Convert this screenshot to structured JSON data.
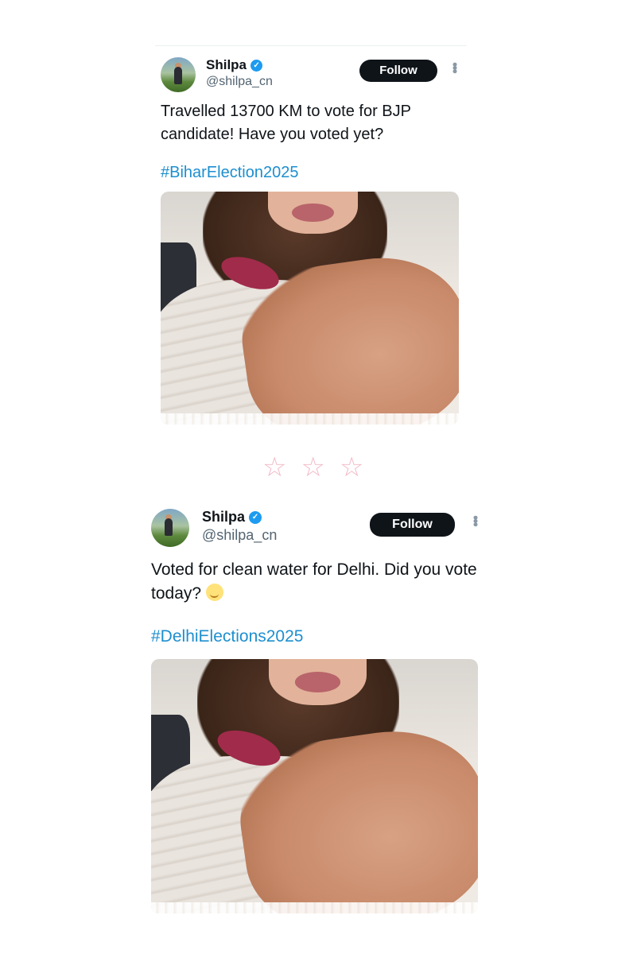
{
  "tweets": [
    {
      "name": "Shilpa",
      "handle": "@shilpa_cn",
      "follow_label": "Follow",
      "more_icon": "vertical-dots",
      "text": "Travelled 13700 KM to vote for BJP candidate!  Have you voted yet?",
      "hashtag": "#BiharElection2025"
    },
    {
      "name": "Shilpa",
      "handle": "@shilpa_cn",
      "follow_label": "Follow",
      "more_icon": "vertical-dots",
      "text": "Voted for clean water for Delhi. Did you vote today?",
      "emoji": "smirk-face",
      "hashtag": "#DelhiElections2025"
    }
  ],
  "divider": {
    "glyphs": "☆☆☆"
  },
  "colors": {
    "hashtag": "#1d8fcf",
    "verified": "#1d9bf0",
    "follow_bg": "#0f1419",
    "stars": "#f2b8c6"
  }
}
